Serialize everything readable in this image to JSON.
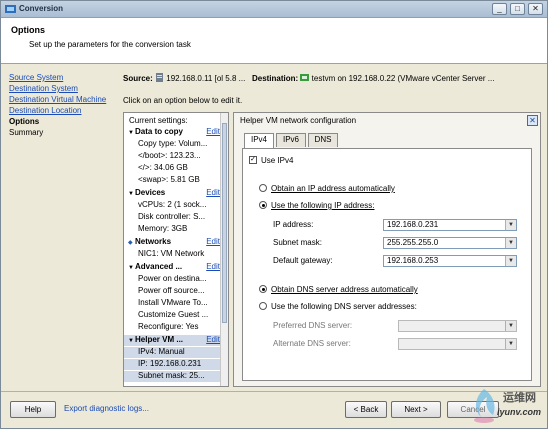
{
  "window": {
    "title": "Conversion",
    "controls": [
      "_",
      "□",
      "✕"
    ]
  },
  "header": {
    "title": "Options",
    "subtitle": "Set up the parameters for the conversion task"
  },
  "nav": {
    "items": [
      {
        "label": "Source System",
        "state": "link"
      },
      {
        "label": "Destination System",
        "state": "link"
      },
      {
        "label": "Destination Virtual Machine",
        "state": "link"
      },
      {
        "label": "Destination Location",
        "state": "link"
      },
      {
        "label": "Options",
        "state": "current"
      },
      {
        "label": "Summary",
        "state": "plain"
      }
    ]
  },
  "srcdst": {
    "source_label": "Source:",
    "source_value": "192.168.0.11 [ol 5.8 ...",
    "dest_label": "Destination:",
    "dest_value": "testvm on 192.168.0.22 (VMware vCenter Server ..."
  },
  "instruction": "Click on an option below to edit it.",
  "settings": {
    "header": "Current settings:",
    "edit_label": "Edit",
    "rows": [
      {
        "type": "section",
        "label": "Data to copy",
        "icon": "triangle-down"
      },
      {
        "type": "item",
        "label": "Copy type: Volum..."
      },
      {
        "type": "item",
        "label": "</boot>: 123.23..."
      },
      {
        "type": "item",
        "label": "</>: 34.06 GB"
      },
      {
        "type": "item",
        "label": "<swap>: 5.81 GB"
      },
      {
        "type": "section",
        "label": "Devices",
        "icon": "triangle-down"
      },
      {
        "type": "item",
        "label": "vCPUs: 2 (1 sock..."
      },
      {
        "type": "item",
        "label": "Disk controller: S..."
      },
      {
        "type": "item",
        "label": "Memory: 3GB"
      },
      {
        "type": "section",
        "label": "Networks",
        "icon": "diamond"
      },
      {
        "type": "item",
        "label": "NIC1: VM Network"
      },
      {
        "type": "section",
        "label": "Advanced ...",
        "icon": "triangle-down"
      },
      {
        "type": "item",
        "label": "Power on destina..."
      },
      {
        "type": "item",
        "label": "Power off source..."
      },
      {
        "type": "item",
        "label": "Install VMware To..."
      },
      {
        "type": "item",
        "label": "Customize Guest ..."
      },
      {
        "type": "item",
        "label": "Reconfigure: Yes"
      },
      {
        "type": "section",
        "label": "Helper VM ...",
        "icon": "triangle-down",
        "selected": true
      },
      {
        "type": "item",
        "label": "IPv4: Manual",
        "selected": true
      },
      {
        "type": "item",
        "label": "IP: 192.168.0.231",
        "selected": true
      },
      {
        "type": "item",
        "label": "Subnet mask: 25...",
        "selected": true
      }
    ]
  },
  "panel": {
    "title": "Helper VM network configuration",
    "close": "✕",
    "tabs": [
      "IPv4",
      "IPv6",
      "DNS"
    ],
    "active_tab": "IPv4",
    "use_ipv4": {
      "label": "Use IPv4",
      "checked": true
    },
    "ip_auto": {
      "label": "Obtain an IP address automatically",
      "selected": false
    },
    "ip_manual": {
      "label": "Use the following IP address:",
      "selected": true
    },
    "ip_address": {
      "label": "IP address:",
      "value": "192.168.0.231"
    },
    "subnet_mask": {
      "label": "Subnet mask:",
      "value": "255.255.255.0"
    },
    "default_gateway": {
      "label": "Default gateway:",
      "value": "192.168.0.253"
    },
    "dns_auto": {
      "label": "Obtain DNS server address automatically",
      "selected": true
    },
    "dns_manual": {
      "label": "Use the following DNS server addresses:",
      "selected": false
    },
    "preferred_dns": {
      "label": "Preferred DNS server:",
      "value": ""
    },
    "alternate_dns": {
      "label": "Alternate DNS server:",
      "value": ""
    }
  },
  "footer": {
    "help": "Help",
    "export_link": "Export diagnostic logs...",
    "back": "< Back",
    "next": "Next >",
    "cancel": "Cancel"
  },
  "watermark": {
    "text": "运维网",
    "url": "iyunv.com"
  }
}
